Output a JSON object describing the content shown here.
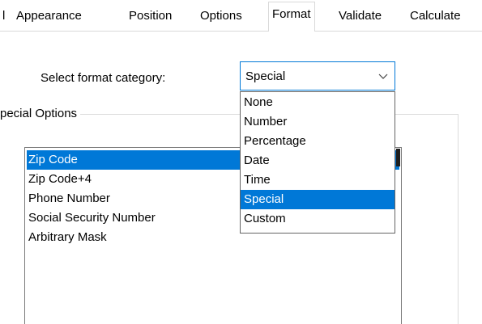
{
  "tabs": [
    {
      "label": "l"
    },
    {
      "label": "Appearance"
    },
    {
      "label": "Position"
    },
    {
      "label": "Options"
    },
    {
      "label": "Format",
      "active": true
    },
    {
      "label": "Validate"
    },
    {
      "label": "Calculate"
    }
  ],
  "format_category": {
    "label": "Select format category:",
    "selected": "Special",
    "arrow_icon": "chevron-down-icon",
    "options": [
      "None",
      "Number",
      "Percentage",
      "Date",
      "Time",
      "Special",
      "Custom"
    ],
    "selected_index": 5
  },
  "special_options": {
    "legend": "pecial Options",
    "items": [
      "Zip Code",
      "Zip Code+4",
      "Phone Number",
      "Social Security Number",
      "Arbitrary Mask"
    ],
    "selected_index": 0
  },
  "colors": {
    "accent": "#0078d7",
    "border": "#7a7a7a",
    "divider": "#d9d9d9"
  }
}
